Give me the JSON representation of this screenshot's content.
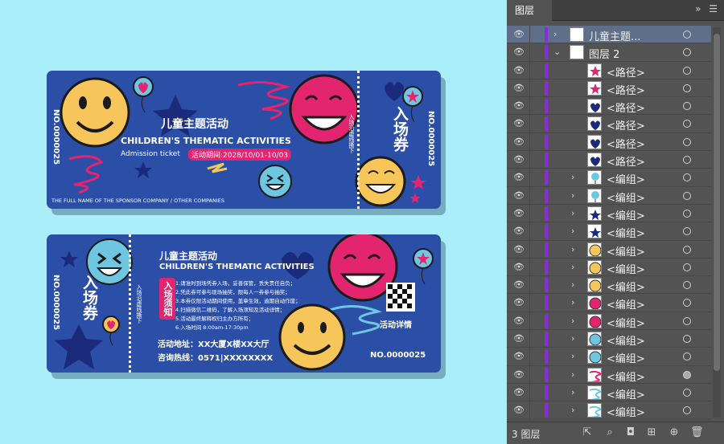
{
  "ticket_top": {
    "title_cn": "儿童主题活动",
    "title_en": "CHILDREN'S THEMATIC ACTIVITIES",
    "subtitle": "Admission ticket",
    "period": "活动期间:2028/10/01-10/03",
    "serial": "NO.0000025",
    "sponsor": "THE FULL NAME OF THE SPONSOR COMPANY / OTHER COMPANIES",
    "stub_title": "入场券",
    "stub_note": "入场沿虚线撕下",
    "stub_serial": "NO.0000025"
  },
  "ticket_bottom": {
    "serial": "NO.0000025",
    "stub_title": "入场券",
    "stub_note": "入场沿虚线撕下",
    "title_cn": "儿童主题活动",
    "title_en": "CHILDREN'S THEMATIC ACTIVITIES",
    "notice_label": "入场须知",
    "rules": [
      "1.请准时到场凭券入场，妥善保管，丢失责任自负；",
      "2.凭此券可参与现场抽奖，限每人一券参与抽奖；",
      "3.本券仅限活动期间使用，盖章生效，逾期自动作废；",
      "4.扫描微信二维码，了解入场须知及活动详情；",
      "5.活动最终解释权归主办方所有；",
      "6.入场时间 8:00am-17:30pm"
    ],
    "address": "活动地址：XX大厦X楼XX大厅",
    "hotline": "咨询热线：0571|XXXXXXXX",
    "qr_caption": "活动详情",
    "serial_right": "NO.0000025"
  },
  "panel": {
    "tab_label": "图层",
    "footer_count": "3 图层",
    "rows": [
      {
        "label": "儿童主题...",
        "indent": 0,
        "expand": "›",
        "selected": true,
        "target_filled": false
      },
      {
        "label": "图层 2",
        "indent": 0,
        "expand": "⌄",
        "selected": false,
        "target_filled": false
      },
      {
        "label": "<路径>",
        "indent": 2,
        "expand": "",
        "selected": false,
        "target_filled": false
      },
      {
        "label": "<路径>",
        "indent": 2,
        "expand": "",
        "selected": false,
        "target_filled": false
      },
      {
        "label": "<路径>",
        "indent": 2,
        "expand": "",
        "selected": false,
        "target_filled": false
      },
      {
        "label": "<路径>",
        "indent": 2,
        "expand": "",
        "selected": false,
        "target_filled": false
      },
      {
        "label": "<路径>",
        "indent": 2,
        "expand": "",
        "selected": false,
        "target_filled": false
      },
      {
        "label": "<路径>",
        "indent": 2,
        "expand": "",
        "selected": false,
        "target_filled": false
      },
      {
        "label": "<编组>",
        "indent": 1,
        "expand": "›",
        "selected": false,
        "target_filled": false
      },
      {
        "label": "<编组>",
        "indent": 1,
        "expand": "›",
        "selected": false,
        "target_filled": false
      },
      {
        "label": "<编组>",
        "indent": 1,
        "expand": "›",
        "selected": false,
        "target_filled": false
      },
      {
        "label": "<编组>",
        "indent": 1,
        "expand": "›",
        "selected": false,
        "target_filled": false
      },
      {
        "label": "<编组>",
        "indent": 1,
        "expand": "›",
        "selected": false,
        "target_filled": false
      },
      {
        "label": "<编组>",
        "indent": 1,
        "expand": "›",
        "selected": false,
        "target_filled": false
      },
      {
        "label": "<编组>",
        "indent": 1,
        "expand": "›",
        "selected": false,
        "target_filled": false
      },
      {
        "label": "<编组>",
        "indent": 1,
        "expand": "›",
        "selected": false,
        "target_filled": false
      },
      {
        "label": "<编组>",
        "indent": 1,
        "expand": "›",
        "selected": false,
        "target_filled": false
      },
      {
        "label": "<编组>",
        "indent": 1,
        "expand": "›",
        "selected": false,
        "target_filled": false
      },
      {
        "label": "<编组>",
        "indent": 1,
        "expand": "›",
        "selected": false,
        "target_filled": false
      },
      {
        "label": "<编组>",
        "indent": 1,
        "expand": "›",
        "selected": false,
        "target_filled": true
      },
      {
        "label": "<编组>",
        "indent": 1,
        "expand": "›",
        "selected": false,
        "target_filled": false
      },
      {
        "label": "<编组>",
        "indent": 1,
        "expand": "›",
        "selected": false,
        "target_filled": false
      }
    ],
    "thumbs": [
      "white",
      "white",
      "pink-star",
      "pink-star",
      "navy-heart",
      "navy-heart",
      "navy-heart",
      "navy-heart",
      "balloon",
      "balloon",
      "star",
      "star",
      "yellow-face",
      "yellow-face",
      "yellow-face",
      "pink-face",
      "pink-face",
      "blue-face",
      "blue-face",
      "pink-scribble",
      "blue-scribble",
      "blue-scribble"
    ]
  },
  "colors": {
    "ticket_blue": "#2b4ea6",
    "pink": "#e3256f",
    "yellow": "#f6c65b",
    "light_blue": "#6ec6e0",
    "navy": "#1b2a7a",
    "canvas_bg": "#a9eef9",
    "panel_bg": "#535353",
    "layer_color": "#8a2be2"
  }
}
